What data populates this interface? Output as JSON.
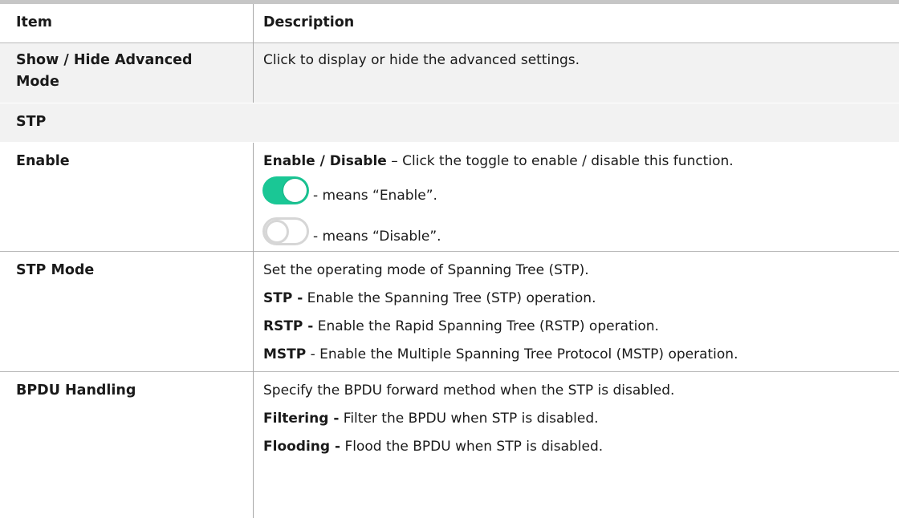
{
  "header": {
    "item": "Item",
    "description": "Description"
  },
  "rows": {
    "show_hide": {
      "item_line1": "Show / Hide Advanced",
      "item_line2": "Mode",
      "description": "Click to display or hide the advanced settings."
    },
    "stp_section": {
      "label": "STP"
    },
    "enable": {
      "item": "Enable",
      "line1_bold": "Enable / Disable",
      "line1_rest": " – Click the toggle to enable / disable this function.",
      "on_caption": " - means “Enable”.",
      "off_caption": " - means “Disable”."
    },
    "stp_mode": {
      "item": "STP Mode",
      "line1": "Set the operating mode of Spanning Tree (STP).",
      "line2_bold": "STP -",
      "line2_rest": " Enable the Spanning Tree (STP) operation.",
      "line3_bold": "RSTP -",
      "line3_rest": " Enable the Rapid Spanning Tree (RSTP) operation.",
      "line4_bold": "MSTP",
      "line4_rest": " - Enable the Multiple Spanning Tree Protocol (MSTP) operation."
    },
    "bpdu": {
      "item": "BPDU Handling",
      "line1": "Specify the BPDU forward method when the STP is disabled.",
      "line2_bold": "Filtering -",
      "line2_rest": " Filter the BPDU when STP is disabled.",
      "line3_bold": "Flooding -",
      "line3_rest": " Flood the BPDU when STP is disabled."
    }
  },
  "colors": {
    "toggle_on": "#1ac795",
    "toggle_off_border": "#d6d6d6",
    "header_rule": "#c6c6c6",
    "shaded_row": "#f2f2f2"
  },
  "icons": {
    "toggle_on": "toggle-on-icon",
    "toggle_off": "toggle-off-icon"
  }
}
